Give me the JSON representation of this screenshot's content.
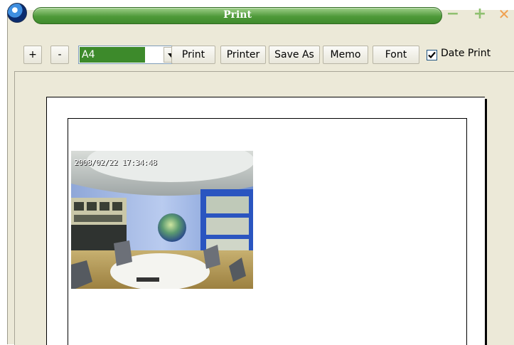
{
  "window": {
    "title": "Print",
    "controls": {
      "minimize": "−",
      "maximize": "+",
      "close": "✕"
    }
  },
  "toolbar": {
    "zoom_in_label": "+",
    "zoom_out_label": "-",
    "paper_size": {
      "selected": "A4"
    },
    "print_label": "Print",
    "printer_label": "Printer",
    "save_as_label": "Save As",
    "memo_label": "Memo",
    "font_label": "Font",
    "date_print": {
      "label": "Date Print",
      "checked": true
    }
  },
  "preview": {
    "snapshot_timestamp": "2008/02/22 17:34:48"
  },
  "colors": {
    "title_bar": "#4f9a3a",
    "selection": "#3d8a2b",
    "window_bg": "#ece9d8"
  }
}
